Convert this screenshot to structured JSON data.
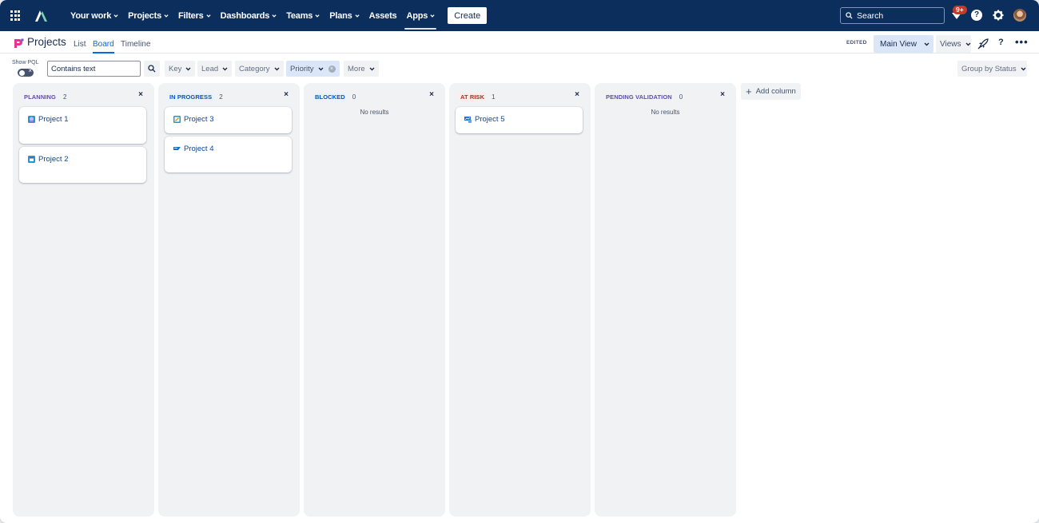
{
  "topnav": {
    "items": [
      {
        "label": "Your work",
        "dropdown": true
      },
      {
        "label": "Projects",
        "dropdown": true
      },
      {
        "label": "Filters",
        "dropdown": true
      },
      {
        "label": "Dashboards",
        "dropdown": true
      },
      {
        "label": "Teams",
        "dropdown": true
      },
      {
        "label": "Plans",
        "dropdown": true
      },
      {
        "label": "Assets",
        "dropdown": false
      },
      {
        "label": "Apps",
        "dropdown": true,
        "active": true
      }
    ],
    "create_label": "Create",
    "search_placeholder": "Search",
    "notification_badge": "9+",
    "help_glyph": "?"
  },
  "subheader": {
    "title": "Projects",
    "tabs": [
      {
        "label": "List",
        "active": false
      },
      {
        "label": "Board",
        "active": true
      },
      {
        "label": "Timeline",
        "active": false
      }
    ],
    "edited_label": "EDITED",
    "view_label": "Main View",
    "views_label": "Views",
    "help_glyph": "?",
    "more_glyph": "•••"
  },
  "filters": {
    "pql_label": "Show PQL",
    "text_value": "Contains text",
    "buttons": [
      {
        "label": "Key",
        "selected": false
      },
      {
        "label": "Lead",
        "selected": false
      },
      {
        "label": "Category",
        "selected": false
      },
      {
        "label": "Priority",
        "selected": true
      },
      {
        "label": "More",
        "selected": false
      }
    ],
    "group_by_label": "Group by Status"
  },
  "board": {
    "no_results_label": "No results",
    "add_column_label": "Add column",
    "columns": [
      {
        "title": "PLANNING",
        "count": "2",
        "text_color": "#5e4db2",
        "bg_color": "#f3f0ff",
        "cards": [
          {
            "title": "Project 1",
            "icon": "robot-icon"
          },
          {
            "title": "Project 2",
            "icon": "box-icon"
          }
        ]
      },
      {
        "title": "IN PROGRESS",
        "count": "2",
        "text_color": "#0055cc",
        "bg_color": "#e9f2ff",
        "cards": [
          {
            "title": "Project 3",
            "icon": "notepad-icon"
          },
          {
            "title": "Project 4",
            "icon": "sap-icon"
          }
        ]
      },
      {
        "title": "BLOCKED",
        "count": "0",
        "text_color": "#0055cc",
        "bg_color": "#e9f2ff",
        "cards": []
      },
      {
        "title": "AT RISK",
        "count": "1",
        "text_color": "#ae2e24",
        "bg_color": "#ffeceb",
        "cards": [
          {
            "title": "Project 5",
            "icon": "chart-doc-icon"
          }
        ]
      },
      {
        "title": "PENDING VALIDATION",
        "count": "0",
        "text_color": "#5e4db2",
        "bg_color": "#f1f2f4",
        "cards": []
      }
    ]
  },
  "colors": {
    "nav_bg": "#0b2e5c",
    "accent": "#0c66e4",
    "card_link": "#0747a6",
    "column_bg": "#f1f2f4"
  }
}
